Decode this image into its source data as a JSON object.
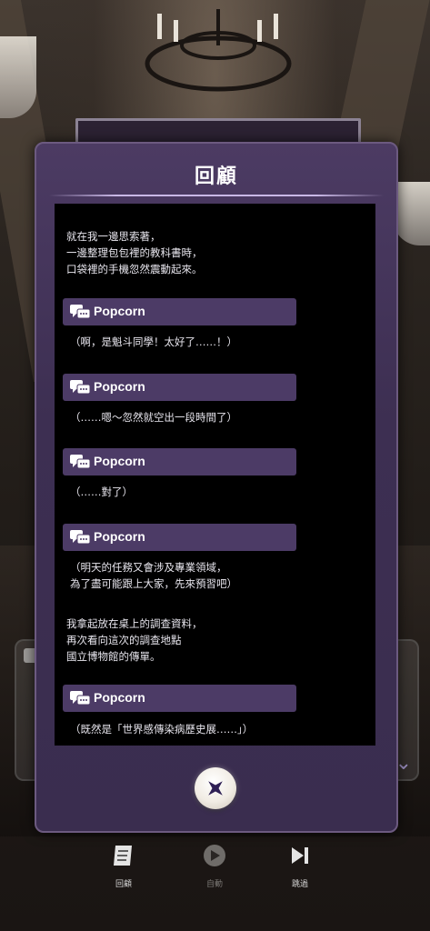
{
  "modal": {
    "title": "回顧"
  },
  "log": {
    "intro": "就在我一邊思索著，\n一邊整理包包裡的教科書時，\n口袋裡的手機忽然震動起來。",
    "entries": [
      {
        "speaker": "Popcorn",
        "text": "（啊，是魁斗同學！太好了……！）"
      },
      {
        "speaker": "Popcorn",
        "text": "（……嗯～忽然就空出一段時間了）"
      },
      {
        "speaker": "Popcorn",
        "text": "（……對了）"
      },
      {
        "speaker": "Popcorn",
        "text": "（明天的任務又會涉及專業領域，\n為了盡可能跟上大家，先來預習吧）"
      },
      {
        "speaker": "Popcorn",
        "text": "（既然是「世界感傳染病歷史展……」）"
      }
    ],
    "narration2": "我拿起放在桌上的調查資料，\n再次看向這次的調查地點\n國立博物館的傳單。"
  },
  "toolbar": {
    "items": [
      {
        "label": "回顧",
        "icon": "scroll-icon"
      },
      {
        "label": "自動",
        "icon": "play-icon"
      },
      {
        "label": "跳過",
        "icon": "skip-icon"
      }
    ]
  },
  "colors": {
    "modal_bg": "#3d2f52",
    "speaker_bar": "#4c3b66",
    "log_bg": "#000000",
    "accent": "#2e1f54"
  }
}
